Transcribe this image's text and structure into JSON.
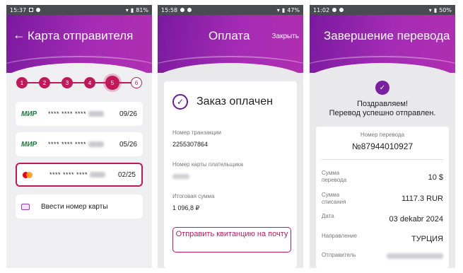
{
  "screen1": {
    "status": {
      "time": "15:37",
      "battery": "81%"
    },
    "title": "Карта отправителя",
    "steps": [
      "1",
      "2",
      "3",
      "4",
      "5",
      "6"
    ],
    "current_step": 5,
    "cards": [
      {
        "brand": "МИР",
        "masked": "**** **** ****",
        "expiry": "09/26"
      },
      {
        "brand": "МИР",
        "masked": "**** **** ****",
        "expiry": "05/26"
      },
      {
        "brand": "mastercard",
        "masked": "**** **** ****",
        "expiry": "02/25"
      }
    ],
    "enter_card_label": "Ввести номер карты"
  },
  "screen2": {
    "status": {
      "time": "15:58",
      "battery": "47%"
    },
    "title": "Оплата",
    "close_label": "Закрыть",
    "paid_title": "Заказ оплачен",
    "transaction_label": "Номер транзакции",
    "transaction_value": "2255307864",
    "payer_card_label": "Номер карты плательщика",
    "total_label": "Итоговая сумма",
    "total_value": "1 096,8 ₽",
    "receipt_button_label": "Отправить квитанцию на почту"
  },
  "screen3": {
    "status": {
      "time": "11:02",
      "battery": "50%"
    },
    "title": "Завершение перевода",
    "congrats_line1": "Поздравляем!",
    "congrats_line2": "Перевод успешно отправлен.",
    "transfer_number_label": "Номер перевода",
    "transfer_number_value": "№87944010927",
    "rows": [
      {
        "label": "Сумма перевода",
        "value": "10 $"
      },
      {
        "label": "Сумма списания",
        "value": "1117.3 RUR"
      },
      {
        "label": "Дата",
        "value": "03 dekabr 2024"
      },
      {
        "label": "Направление",
        "value": "ТУРЦИЯ"
      },
      {
        "label": "Отправитель",
        "value": ""
      }
    ]
  },
  "colors": {
    "accent": "#c2185b",
    "header_purple": "#8e24aa",
    "mir_green": "#1b7a3e"
  }
}
